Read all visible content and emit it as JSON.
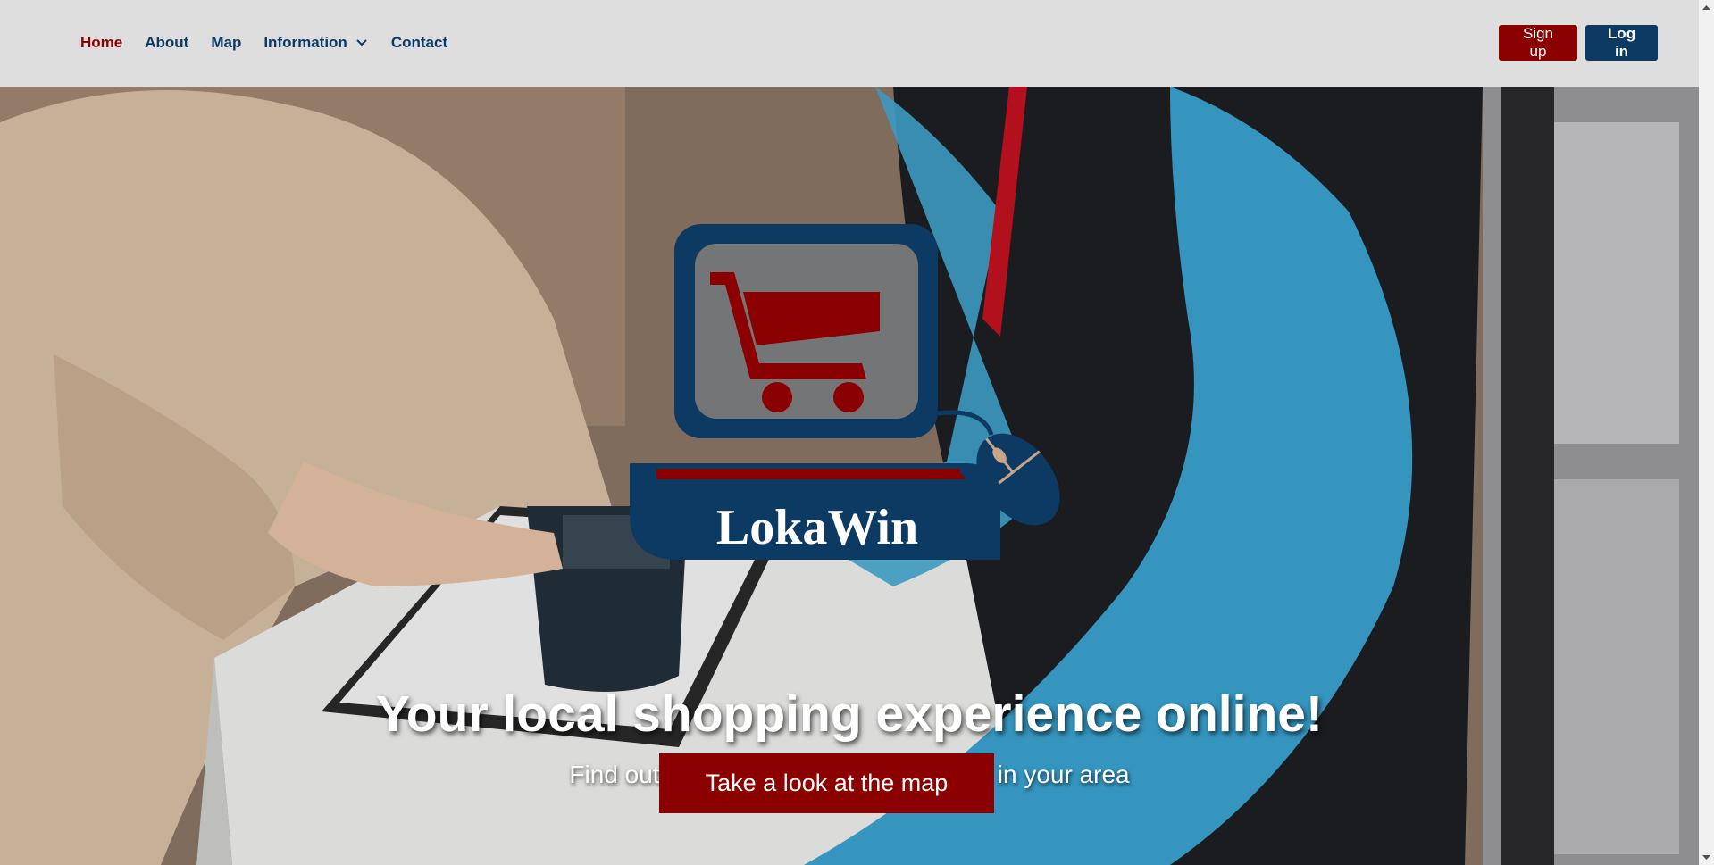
{
  "nav": {
    "links": [
      {
        "label": "Home"
      },
      {
        "label": "About"
      },
      {
        "label": "Map"
      },
      {
        "label": "Information"
      },
      {
        "label": "Contact"
      }
    ],
    "signup_label": "Sign up",
    "login_label": "Log in"
  },
  "logo": {
    "text": "LokaWin",
    "icon": "shopping-cart-computer-mouse-logo"
  },
  "hero": {
    "title": "Your local shopping experience online!",
    "subtitle": "Find out which stores are participating in your area",
    "cta_label": "Take a look at the map"
  },
  "colors": {
    "brand_red": "#8b0000",
    "brand_blue": "#0d3a63",
    "navbar_bg": "#dedede"
  }
}
